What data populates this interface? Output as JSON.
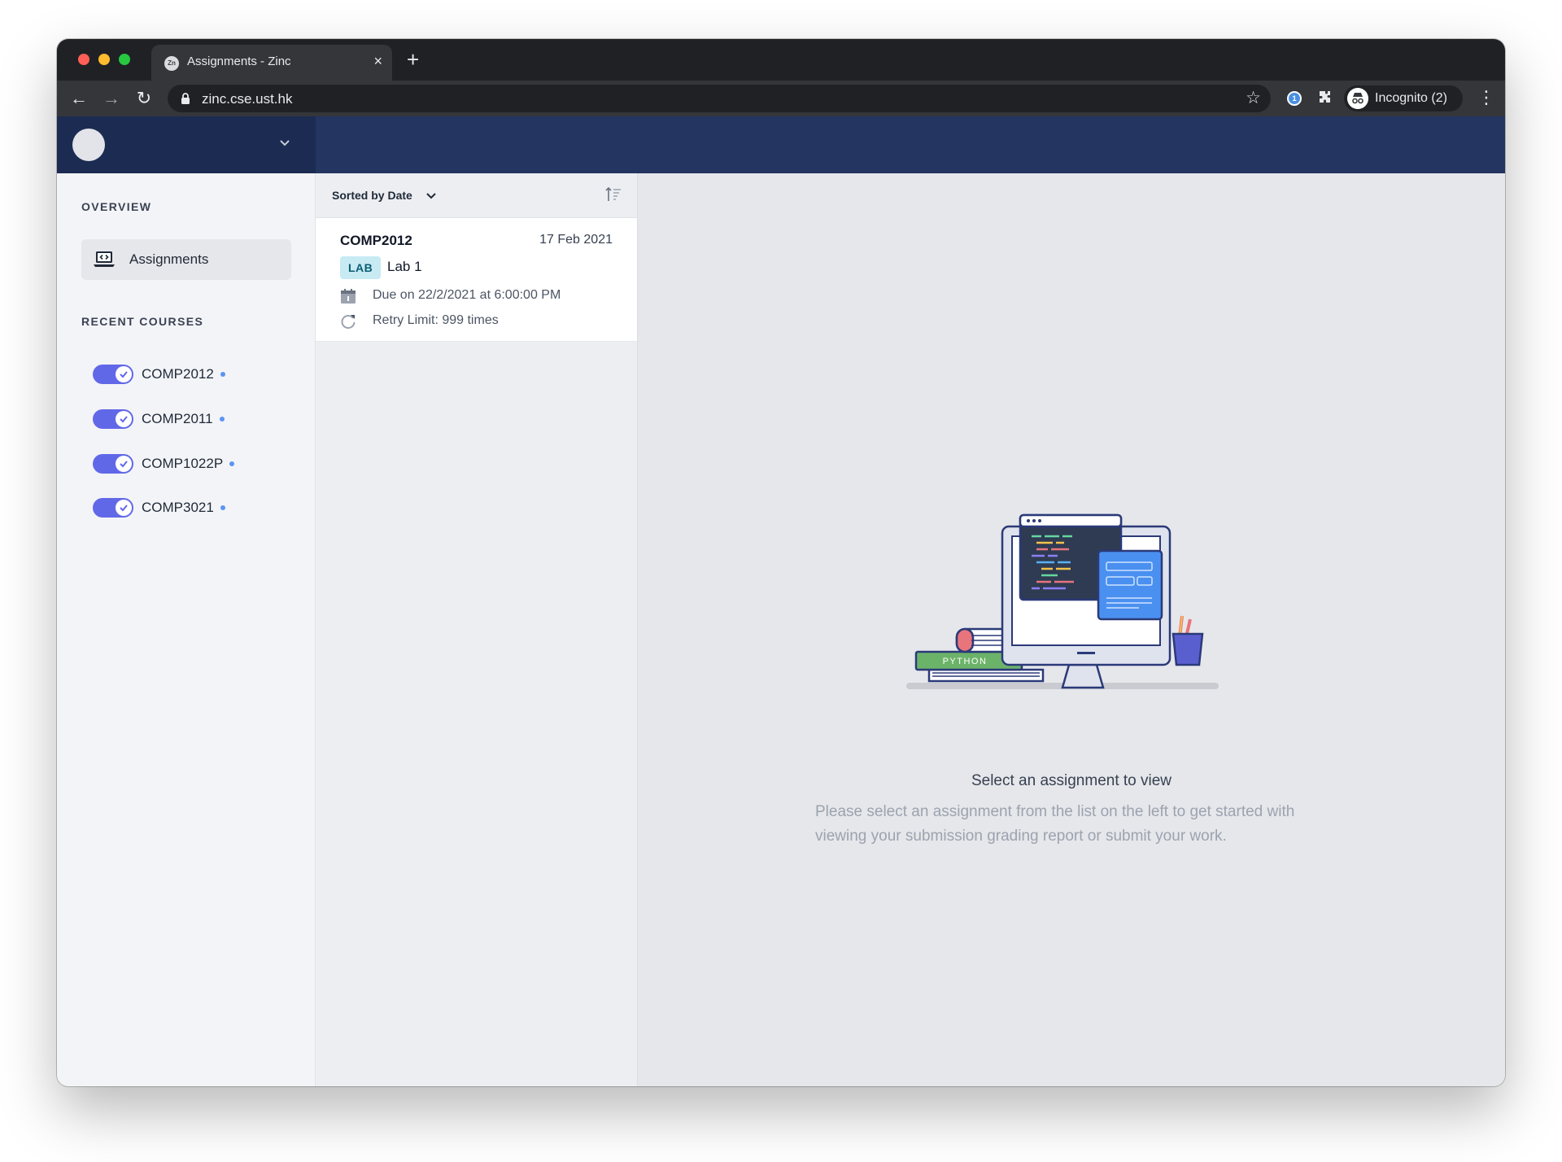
{
  "browser": {
    "tab_title": "Assignments - Zinc",
    "tab_favicon_text": "Zn",
    "tab_close": "×",
    "new_tab": "+",
    "url": "zinc.cse.ust.hk",
    "profile_label": "Incognito (2)",
    "icons": {
      "back": "←",
      "forward": "→",
      "reload": "↻",
      "bookmark": "☆",
      "menu": "⋮"
    }
  },
  "sidebar": {
    "overview_label": "OVERVIEW",
    "nav_assignments_label": "Assignments",
    "recent_courses_label": "RECENT COURSES",
    "courses": [
      {
        "code": "COMP2012",
        "enabled": true
      },
      {
        "code": "COMP2011",
        "enabled": true
      },
      {
        "code": "COMP1022P",
        "enabled": true
      },
      {
        "code": "COMP3021",
        "enabled": true
      }
    ]
  },
  "list": {
    "sort_label": "Sorted by Date",
    "assignments": [
      {
        "course": "COMP2012",
        "date": "17 Feb 2021",
        "type_badge": "LAB",
        "title": "Lab 1",
        "due": "Due on 22/2/2021 at 6:00:00 PM",
        "retry": "Retry Limit: 999 times"
      }
    ]
  },
  "main": {
    "illustration_label": "PYTHON",
    "empty_title": "Select an assignment to view",
    "empty_description": "Please select an assignment from the list on the left to get started with viewing your submission grading report or submit your work."
  },
  "colors": {
    "header_bg": "#233560",
    "toggle_on": "#6168e8",
    "badge_bg": "#c7eaf3",
    "course_dot": "#5a94f5"
  }
}
